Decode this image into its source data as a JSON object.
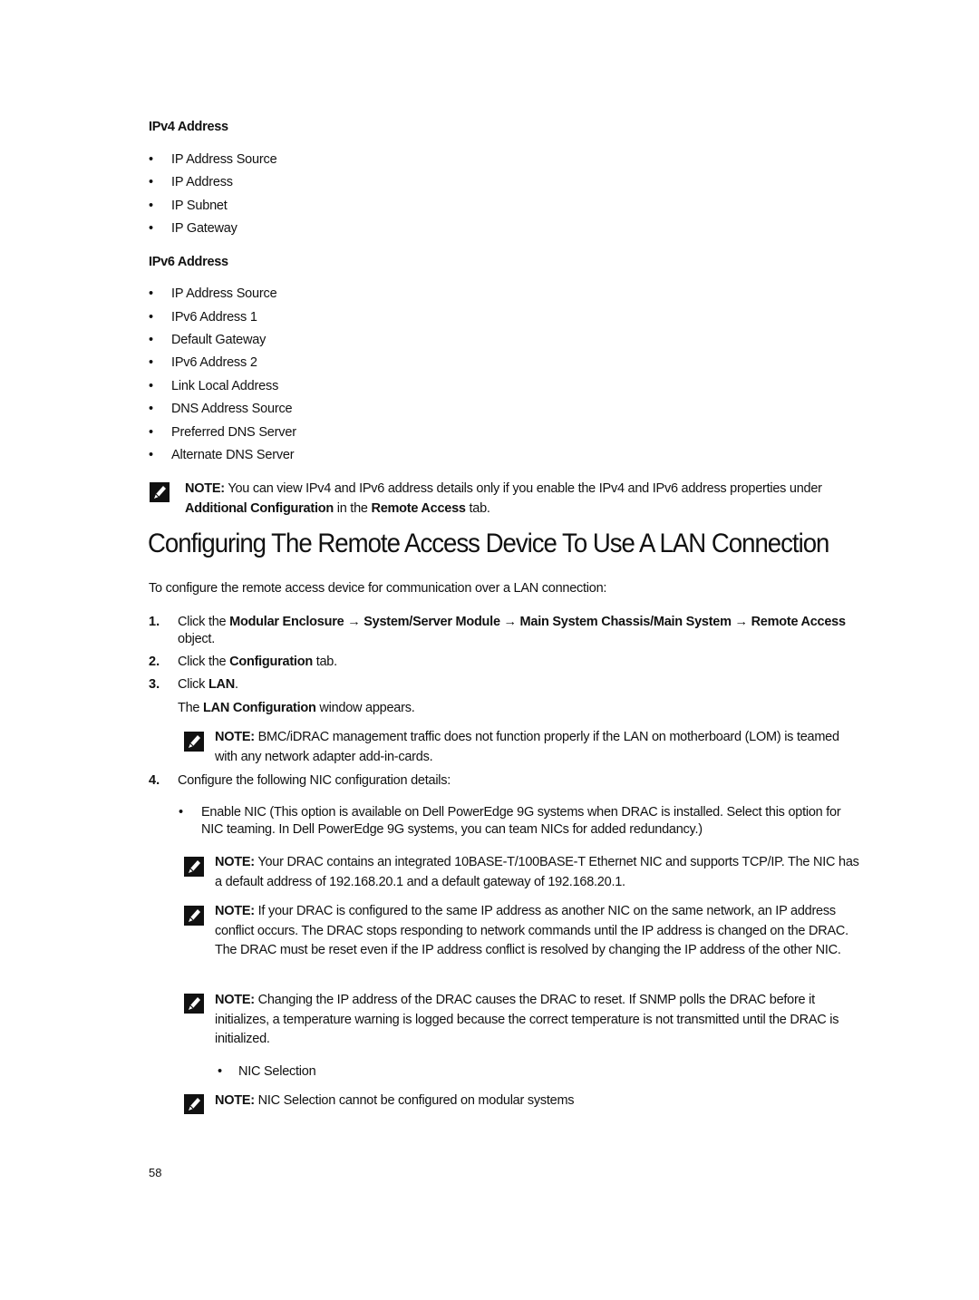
{
  "ipv4": {
    "heading": "IPv4 Address",
    "items": [
      "IP Address Source",
      "IP Address",
      "IP Subnet",
      "IP Gateway"
    ]
  },
  "ipv6": {
    "heading": "IPv6 Address",
    "items": [
      "IP Address Source",
      "IPv6 Address 1",
      "Default Gateway",
      "IPv6 Address 2",
      "Link Local Address",
      "DNS Address Source",
      "Preferred DNS Server",
      "Alternate DNS Server"
    ]
  },
  "bullet_glyph": "•",
  "note_label": "NOTE:",
  "note1": {
    "text_a": " You can view IPv4 and IPv6 address details only if you enable the IPv4 and IPv6 address properties under ",
    "bold_b": "Additional Configuration",
    "text_c": " in the ",
    "bold_d": "Remote Access",
    "text_e": " tab."
  },
  "section": {
    "title": "Configuring The Remote Access Device To Use A LAN Connection",
    "intro": "To configure the remote access device for communication over a LAN connection:"
  },
  "steps": [
    {
      "num": "1.",
      "text_a": "Click the ",
      "bold_b": "Modular Enclosure → System/Server Module → Main System Chassis/Main System → Remote Access",
      "text_c": " object."
    },
    {
      "num": "2.",
      "text_a": "Click the ",
      "bold_b": "Configuration",
      "text_c": " tab."
    },
    {
      "num": "3.",
      "text_a": "Click ",
      "bold_b": "LAN",
      "text_c": ".",
      "result_a": "The ",
      "result_bold": "LAN Configuration",
      "result_c": " window appears."
    },
    {
      "num": "4.",
      "text_a": "Configure the following NIC configuration details:"
    }
  ],
  "note_lom": " BMC/iDRAC management traffic does not function properly if the LAN on motherboard (LOM) is teamed with any network adapter add-in-cards.",
  "enable_nic": "Enable NIC (This option is available on Dell PowerEdge 9G systems when DRAC is installed. Select this option for NIC teaming. In Dell PowerEdge 9G systems, you can team NICs for added redundancy.)",
  "note_nic": " Your DRAC contains an integrated 10BASE-T/100BASE-T Ethernet NIC and supports TCP/IP. The NIC has a default address of 192.168.20.1 and a default gateway of 192.168.20.1.",
  "note_conflict": " If your DRAC is configured to the same IP address as another NIC on the same network, an IP address conflict occurs. The DRAC stops responding to network commands until the IP address is changed on the DRAC. The DRAC must be reset even if the IP address conflict is resolved by changing the IP address of the other NIC.",
  "note_reset": " Changing the IP address of the DRAC causes the DRAC to reset. If SNMP polls the DRAC before it initializes, a temperature warning is logged because the correct temperature is not transmitted until the DRAC is initialized.",
  "nic_selection": "NIC Selection",
  "note_modular": " NIC Selection cannot be configured on modular systems",
  "page_number": "58"
}
